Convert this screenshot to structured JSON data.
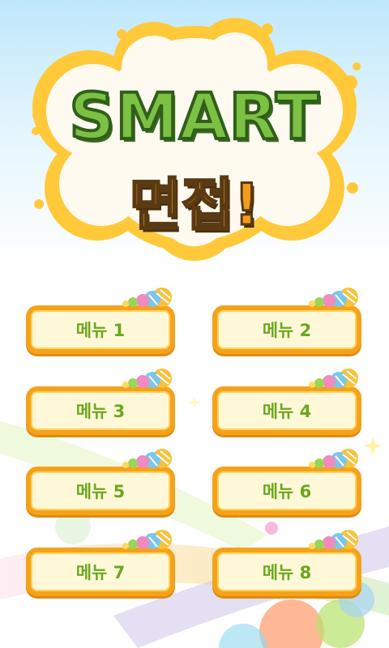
{
  "logo": {
    "title": "SMART",
    "subtitle": "면접!"
  },
  "menu": {
    "items": [
      {
        "label": "메뉴 1"
      },
      {
        "label": "메뉴 2"
      },
      {
        "label": "메뉴 3"
      },
      {
        "label": "메뉴 4"
      },
      {
        "label": "메뉴 5"
      },
      {
        "label": "메뉴 6"
      },
      {
        "label": "메뉴 7"
      },
      {
        "label": "메뉴 8"
      }
    ]
  },
  "colors": {
    "button_border": "#f5a21b",
    "button_fill": "#fff8d8",
    "label_text": "#6aa81e",
    "sky": "#bfe8fb"
  }
}
